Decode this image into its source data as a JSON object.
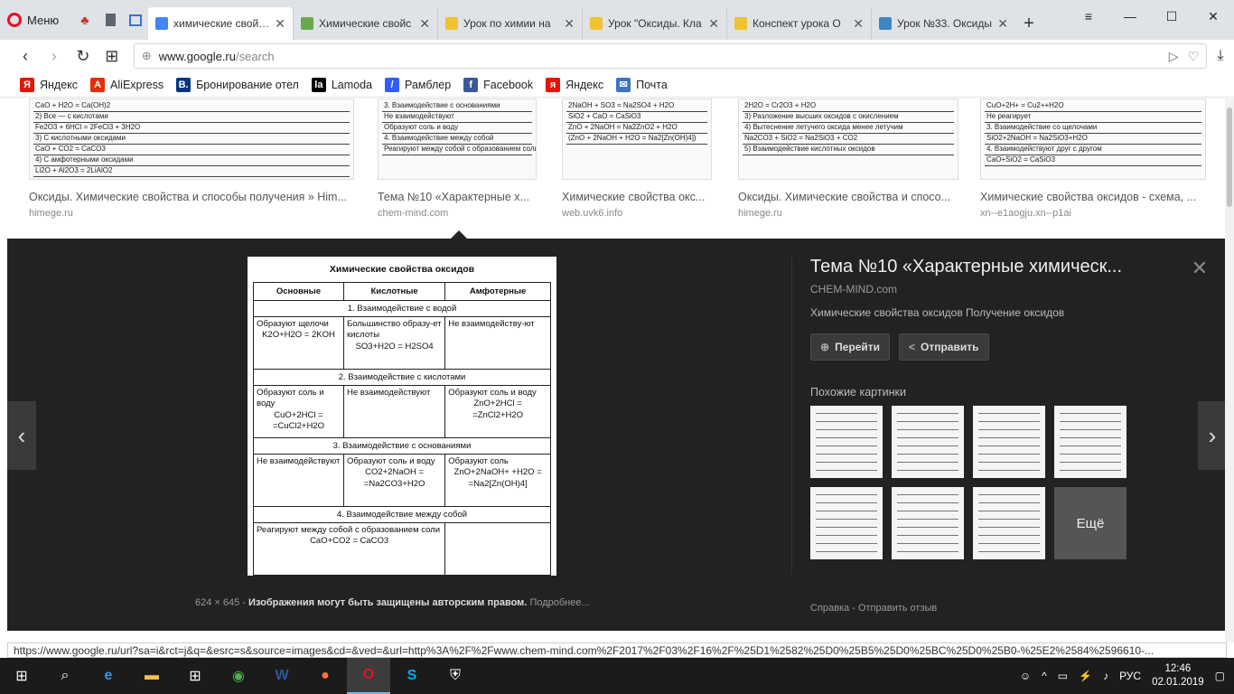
{
  "browser": {
    "menu_label": "Меню",
    "tabs": [
      {
        "label": "химические свойства",
        "active": true,
        "favicon_color": "#4285f4"
      },
      {
        "label": "Химические свойс",
        "active": false,
        "favicon_color": "#6aa84f"
      },
      {
        "label": "Урок по химии на",
        "active": false,
        "favicon_color": "#f1c232"
      },
      {
        "label": "Урок \"Оксиды. Кла",
        "active": false,
        "favicon_color": "#f1c232"
      },
      {
        "label": "Конспект урока О",
        "active": false,
        "favicon_color": "#f1c232"
      },
      {
        "label": "Урок №33. Оксиды",
        "active": false,
        "favicon_color": "#3d85c6"
      }
    ],
    "url_host": "www.google.ru",
    "url_path": "/search",
    "bookmarks": [
      {
        "label": "Яндекс",
        "icon": "yandex-icon",
        "color": "#e61400",
        "glyph": "Я"
      },
      {
        "label": "AliExpress",
        "icon": "aliexpress-icon",
        "color": "#e62e04",
        "glyph": "A"
      },
      {
        "label": "Бронирование отел",
        "icon": "booking-icon",
        "color": "#003580",
        "glyph": "B."
      },
      {
        "label": "Lamoda",
        "icon": "lamoda-icon",
        "color": "#000000",
        "glyph": "la"
      },
      {
        "label": "Рамблер",
        "icon": "rambler-icon",
        "color": "#315efb",
        "glyph": "/"
      },
      {
        "label": "Facebook",
        "icon": "facebook-icon",
        "color": "#3b5998",
        "glyph": "f"
      },
      {
        "label": "Яндекс",
        "icon": "yandex-icon",
        "color": "#e61400",
        "glyph": "я"
      },
      {
        "label": "Почта",
        "icon": "mail-icon",
        "color": "#3d72c6",
        "glyph": "✉"
      }
    ]
  },
  "results": [
    {
      "title": "Оксиды. Химические свойства и способы получения » Him...",
      "source": "himege.ru",
      "snippets": [
        "CaO + H2O = Ca(OH)2",
        "2) Все — с кислотами",
        "Fe2O3 + 6HCl = 2FeCl3 + 3H2O",
        "3) С кислотными оксидами",
        "CaO + CO2 = CaCO3",
        "4) С амфотерными оксидами",
        "Li2O + Al2O3 = 2LiAlO2"
      ]
    },
    {
      "title": "Тема №10 «Характерные х...",
      "source": "chem-mind.com",
      "snippets": [
        "3. Взаимодействие с основаниями",
        "Не взаимодействуют",
        "Образуют соль и воду",
        "4. Взаимодействие между собой",
        "Реагируют между собой с образованием соли"
      ]
    },
    {
      "title": "Химические свойства окс...",
      "source": "web.uvk6.info",
      "snippets": [
        "2NaOH + SO3 = Na2SO4 + H2O",
        "SiO2 + CaO = CaSiO3",
        "ZnO + 2NaOH = Na2ZnO2 + H2O",
        "(ZnO + 2NaOH + H2O = Na2[Zn(OH)4])"
      ]
    },
    {
      "title": "Оксиды. Химические свойства и спосо...",
      "source": "himege.ru",
      "snippets": [
        "2H2O = Cr2O3 + H2O",
        "3) Разложение высших оксидов с окислением",
        "4) Вытеснение летучего оксида менее летучим",
        "Na2CO3 + SiO2 = Na2SiO3 + CO2",
        "5) Взаимодействие кислотных оксидов"
      ]
    },
    {
      "title": "Химические свойства оксидов - схема, ...",
      "source": "xn--e1aogju.xn--p1ai",
      "snippets": [
        "CuO+2H+ = Cu2++H2O",
        "Не реагирует",
        "3. Взаимодействие со щелочами",
        "SiO2+2NaOH = Na2SiO3+H2O",
        "4. Взаимодействуют друг с другом",
        "CaO+SiO2 = CaSiO3"
      ]
    }
  ],
  "preview": {
    "image": {
      "title": "Химические свойства оксидов",
      "headers": [
        "Основные",
        "Кислотные",
        "Амфотерные"
      ],
      "sections": [
        {
          "name": "1. Взаимодействие с водой",
          "cells": [
            {
              "text": "Образуют щелочи",
              "eq": "K2O+H2O = 2KOH"
            },
            {
              "text": "Большинство образу-ет кислоты",
              "eq": "SO3+H2O = H2SO4"
            },
            {
              "text": "Не взаимодейству-ют",
              "eq": ""
            }
          ]
        },
        {
          "name": "2. Взаимодействие с кислотами",
          "cells": [
            {
              "text": "Образуют соль и воду",
              "eq": "CuO+2HCl = =CuCl2+H2O"
            },
            {
              "text": "Не взаимодействуют",
              "eq": ""
            },
            {
              "text": "Образуют соль и воду",
              "eq": "ZnO+2HCl = =ZnCl2+H2O"
            }
          ]
        },
        {
          "name": "3. Взаимодействие с основаниями",
          "cells": [
            {
              "text": "Не взаимодействуют",
              "eq": ""
            },
            {
              "text": "Образуют соль и воду",
              "eq": "CO2+2NaOH = =Na2CO3+H2O"
            },
            {
              "text": "Образуют соль",
              "eq": "ZnO+2NaOH+ +H2O = =Na2[Zn(OH)4]"
            }
          ]
        },
        {
          "name": "4. Взаимодействие между собой",
          "cells": [
            {
              "text": "Реагируют между собой с образованием соли",
              "eq": "CaO+CO2 = CaCO3",
              "colspan": 2
            },
            {
              "text": "",
              "eq": ""
            }
          ]
        }
      ]
    },
    "dimensions": "624 × 645",
    "copyright": "Изображения могут быть защищены авторским правом.",
    "more_link": "Подробнее...",
    "title": "Тема №10 «Характерные химическ...",
    "host": "CHEM-MIND.com",
    "description": "Химические свойства оксидов Получение оксидов",
    "visit_label": "Перейти",
    "share_label": "Отправить",
    "similar_label": "Похожие картинки",
    "more_label": "Ещё",
    "footer_help": "Справка",
    "footer_feedback": "Отправить отзыв"
  },
  "status_url": "https://www.google.ru/url?sa=i&rct=j&q=&esrc=s&source=images&cd=&ved=&url=http%3A%2F%2Fwww.chem-mind.com%2F2017%2F03%2F16%2F%25D1%2582%25D0%25B5%25D0%25BC%25D0%25B0-%25E2%2584%2596610-...",
  "taskbar": {
    "lang": "РУС",
    "time": "12:46",
    "date": "02.01.2019"
  }
}
